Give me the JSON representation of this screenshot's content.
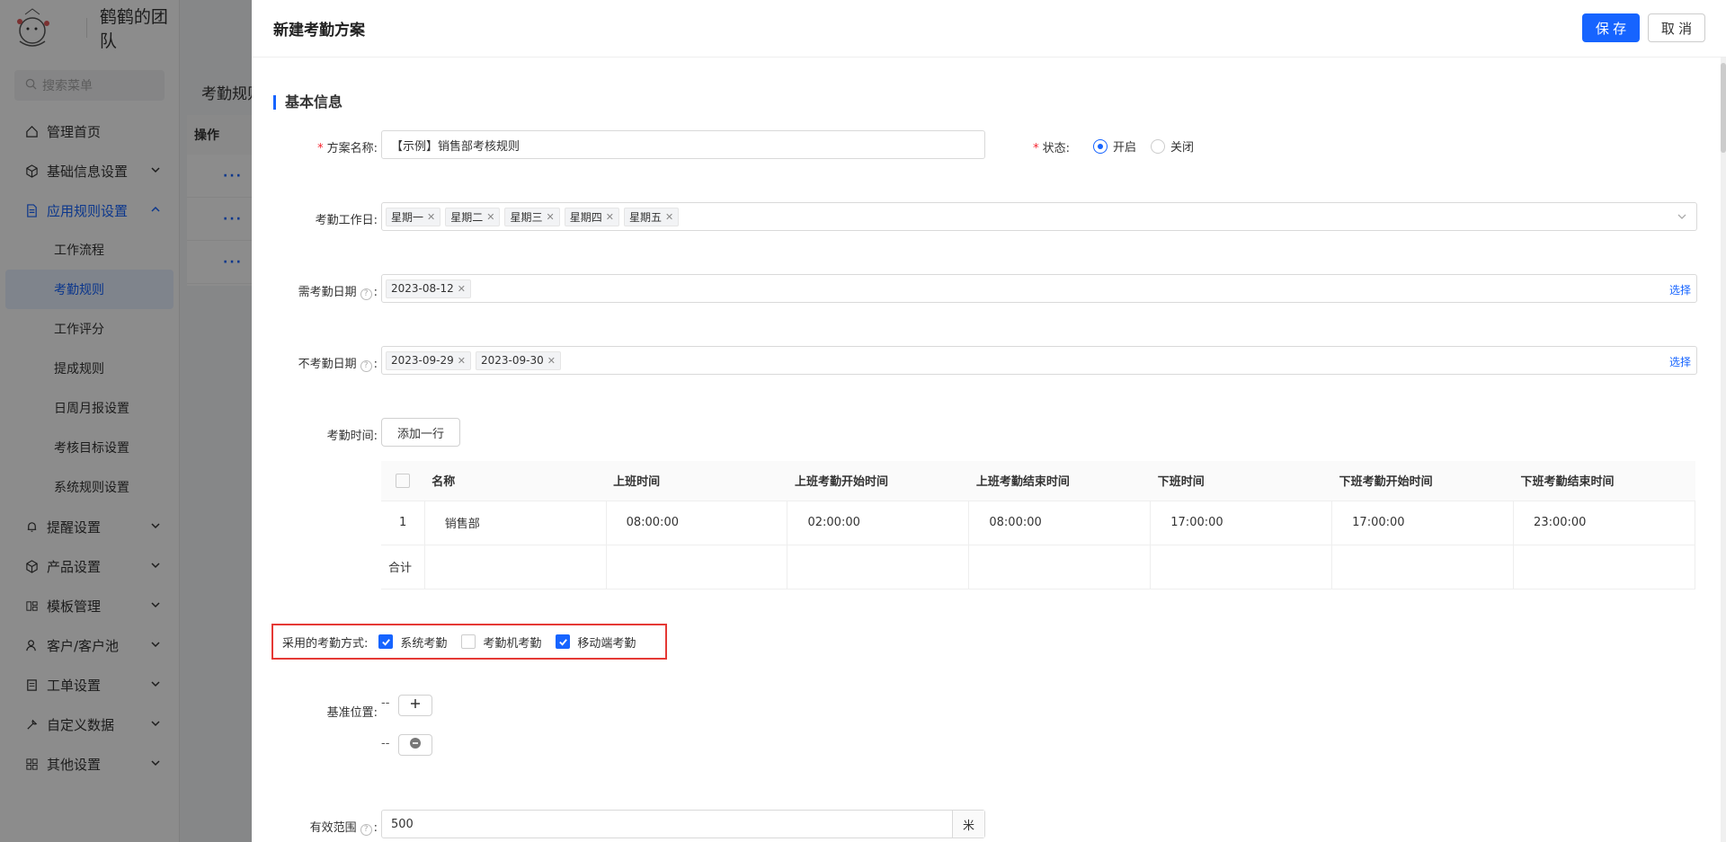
{
  "sidebar": {
    "team_name": "鹤鹤的团队",
    "search_placeholder": "搜索菜单",
    "items": [
      {
        "label": "管理首页",
        "icon": "home-icon"
      },
      {
        "label": "基础信息设置",
        "icon": "cube-icon"
      },
      {
        "label": "应用规则设置",
        "icon": "document-icon",
        "active": true
      },
      {
        "label": "提醒设置",
        "icon": "bell-icon"
      },
      {
        "label": "产品设置",
        "icon": "cube-icon"
      },
      {
        "label": "模板管理",
        "icon": "template-icon"
      },
      {
        "label": "客户/客户池",
        "icon": "user-icon"
      },
      {
        "label": "工单设置",
        "icon": "ticket-icon"
      },
      {
        "label": "自定义数据",
        "icon": "tools-icon"
      },
      {
        "label": "其他设置",
        "icon": "grid-icon"
      }
    ],
    "subitems": [
      "工作流程",
      "考勤规则",
      "工作评分",
      "提成规则",
      "日周月报设置",
      "考核目标设置",
      "系统规则设置"
    ]
  },
  "background": {
    "page_title": "考勤规则",
    "table_header": "操作",
    "row_action": "···"
  },
  "drawer": {
    "title": "新建考勤方案",
    "save_label": "保 存",
    "cancel_label": "取 消",
    "section_title": "基本信息",
    "plan_name_label": "方案名称:",
    "plan_name_value": "【示例】销售部考核规则",
    "status_label": "状态:",
    "status_on": "开启",
    "status_off": "关闭",
    "workdays_label": "考勤工作日:",
    "workdays": [
      "星期一",
      "星期二",
      "星期三",
      "星期四",
      "星期五"
    ],
    "required_dates_label": "需考勤日期",
    "required_dates": [
      "2023-08-12"
    ],
    "excluded_dates_label": "不考勤日期",
    "excluded_dates": [
      "2023-09-29",
      "2023-09-30"
    ],
    "select_link": "选择",
    "time_label": "考勤时间:",
    "add_row_label": "添加一行",
    "table": {
      "headers": [
        "名称",
        "上班时间",
        "上班考勤开始时间",
        "上班考勤结束时间",
        "下班时间",
        "下班考勤开始时间",
        "下班考勤结束时间"
      ],
      "rows": [
        {
          "index": "1",
          "cells": [
            "销售部",
            "08:00:00",
            "02:00:00",
            "08:00:00",
            "17:00:00",
            "17:00:00",
            "23:00:00"
          ]
        }
      ],
      "total_label": "合计"
    },
    "method_label": "采用的考勤方式:",
    "methods": [
      {
        "label": "系统考勤",
        "checked": true
      },
      {
        "label": "考勤机考勤",
        "checked": false
      },
      {
        "label": "移动端考勤",
        "checked": true
      }
    ],
    "location_label": "基准位置:",
    "location_placeholder_1": "--",
    "location_placeholder_2": "--",
    "range_label": "有效范围",
    "range_value": "500",
    "range_unit": "米"
  },
  "colors": {
    "accent": "#1664ff",
    "highlight_box": "#e53935",
    "required": "#f5222d"
  }
}
